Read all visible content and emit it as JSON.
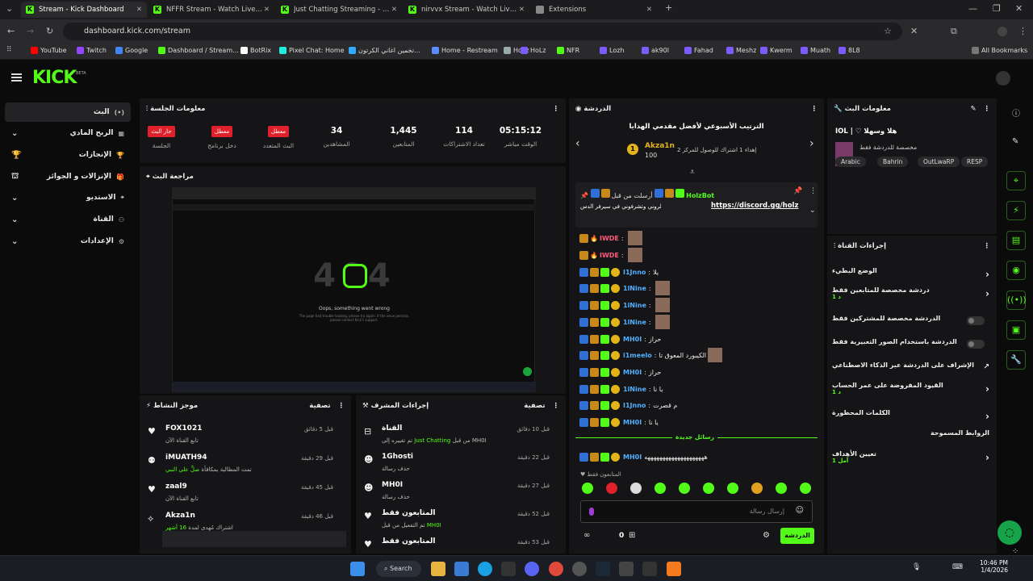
{
  "browser": {
    "tabs": [
      {
        "label": "Stream - Kick Dashboard",
        "active": true
      },
      {
        "label": "NFFR Stream - Watch Live on Ki",
        "active": false
      },
      {
        "label": "Just Chatting Streaming - Live",
        "active": false
      },
      {
        "label": "nirvvx Stream - Watch Live on K",
        "active": false
      },
      {
        "label": "Extensions",
        "active": false
      }
    ],
    "url": "dashboard.kick.com/stream",
    "bookmarks": [
      "YouTube",
      "Twitch",
      "Google",
      "Dashboard / Stream...",
      "BotRix",
      "Pixel Chat: Home",
      "تخمين اغاني الكرتون...",
      "Home - Restream",
      "HoLz",
      "HoLz",
      "NFR",
      "Lozh",
      "ak90l",
      "Fahad",
      "Meshz",
      "Kwerm",
      "Muath",
      "8L8"
    ],
    "all_bookmarks": "All Bookmarks"
  },
  "kick": {
    "logo": "KICK",
    "beta": "BETA"
  },
  "sidebar": {
    "items": [
      {
        "label": "البث",
        "icon": "(•)"
      },
      {
        "label": "الربح المادي",
        "icon": "▦"
      },
      {
        "label": "الإنجازات",
        "icon": "🏆"
      },
      {
        "label": "الإنزالات و الجوائز",
        "icon": "🎁"
      },
      {
        "label": "الاستديو",
        "icon": "⌖"
      },
      {
        "label": "القناة",
        "icon": "⚇"
      },
      {
        "label": "الإعدادات",
        "icon": "⚙"
      }
    ]
  },
  "session": {
    "title": "معلومات الجلسة",
    "stats": [
      {
        "value": "05:15:12",
        "label": "الوقت مباشر"
      },
      {
        "value": "114",
        "label": "تعداد الاشتراكات"
      },
      {
        "value": "1,445",
        "label": "المتابعين"
      },
      {
        "value": "34",
        "label": "المشاهدين"
      },
      {
        "value": "معطل",
        "label": "البث المتعدد",
        "badge": true
      },
      {
        "value": "معطل",
        "label": "دخل برنامج",
        "badge": true
      },
      {
        "value": "جار البث",
        "label": "الجلسة",
        "badge": true
      }
    ]
  },
  "preview": {
    "title": "مراجعة البث",
    "error_code": "404",
    "error_text": "Oops, something went wrong",
    "error_sub": "The page had trouble loading, please try again. If the issue persists, please contact Kick's support."
  },
  "activity": {
    "title": "موجز النشاط",
    "filter": "تصفية",
    "items": [
      {
        "name": "FOX1021",
        "desc": "تابع القناة الآن",
        "time": "قبل 5 دقائق",
        "icon": "heart-icon",
        "glyph": "♥"
      },
      {
        "name": "iMUATH94",
        "desc": "تمت المطالبة بمكافأة",
        "desc_highlight": "صلِّ على النبي",
        "time": "قبل 29 دقيقة",
        "icon": "reward-icon",
        "glyph": "⚉"
      },
      {
        "name": "zaal9",
        "desc": "تابع القناة الآن",
        "time": "قبل 45 دقيقة",
        "icon": "heart-icon",
        "glyph": "♥"
      },
      {
        "name": "Akza1n",
        "desc": "اشتراك مُهدى لمدة",
        "desc_highlight": "16 أشهر",
        "time": "قبل 46 دقيقة",
        "icon": "gift-icon",
        "glyph": "⟡"
      }
    ]
  },
  "mod": {
    "title": "إجراءات المشرف",
    "filter": "تصفية",
    "items": [
      {
        "name": "القناة",
        "desc": "تم تغييره إلى",
        "desc_highlight": "Just Chatting",
        "desc_tail": "من قبل MH0I",
        "time": "قبل 10 دقائق",
        "icon": "channel-icon",
        "glyph": "⊟"
      },
      {
        "name": "1Ghosti",
        "desc": "حذف رسالة",
        "time": "قبل 22 دقيقة",
        "icon": "user-icon",
        "glyph": "☻"
      },
      {
        "name": "MH0I",
        "desc": "حذف رسالة",
        "time": "قبل 27 دقيقة",
        "icon": "user-icon",
        "glyph": "☻"
      },
      {
        "name": "المتابعون فقط",
        "desc": "تم التفعيل من قبل",
        "desc_highlight": "MH0I",
        "time": "قبل 52 دقيقة",
        "icon": "heart-icon",
        "glyph": "♥"
      },
      {
        "name": "المتابعون فقط",
        "desc": "",
        "time": "قبل 53 دقيقة",
        "icon": "heart-icon",
        "glyph": "♥"
      }
    ]
  },
  "chat": {
    "title": "الدردشة",
    "leaderboard_title": "الترتيب الأسبوعي لأفضل مقدمي الهدايا",
    "top_gifter": {
      "rank": "1",
      "name": "Akza1n",
      "amount": "100"
    },
    "second_hint": "إهداء 1 اشتراك للوصول للمركز 2",
    "pinned": {
      "by": "أرسلت من قبل",
      "user": "HolzBot",
      "text": "حياكم للروني وتشرفوني في سيرفر الدس",
      "link": "https://discord.gg/holz"
    },
    "messages": [
      {
        "user": "IWDE",
        "color": "#ff5a7a",
        "text": "",
        "sticker": true
      },
      {
        "user": "IWDE",
        "color": "#ff5a7a",
        "text": "",
        "sticker": true
      },
      {
        "user": "I1Jnno",
        "color": "#4fb0ff",
        "text": "يلا",
        "sticker": false
      },
      {
        "user": "1lNine",
        "color": "#4fb0ff",
        "text": "",
        "sticker": true
      },
      {
        "user": "1lNine",
        "color": "#4fb0ff",
        "text": "",
        "sticker": true
      },
      {
        "user": "1lNine",
        "color": "#4fb0ff",
        "text": "",
        "sticker": true
      },
      {
        "user": "MH0I",
        "color": "#4fb0ff",
        "text": "حراز",
        "sticker": false
      },
      {
        "user": "i1meelo",
        "color": "#4fb0ff",
        "text": "الكيبورد المعوق تا",
        "sticker": true
      },
      {
        "user": "MH0I",
        "color": "#4fb0ff",
        "text": "حراز",
        "sticker": false
      },
      {
        "user": "1lNine",
        "color": "#4fb0ff",
        "text": "يا نا",
        "sticker": false
      },
      {
        "user": "I1Jnno",
        "color": "#4fb0ff",
        "text": "م قصرت",
        "sticker": false
      },
      {
        "user": "MH0I",
        "color": "#4fb0ff",
        "text": "يا نا",
        "sticker": false
      }
    ],
    "new_messages": "رسائل جديدة",
    "last_msg": {
      "user": "MH0I",
      "text": "ههههههههههههههههههههه"
    },
    "followers_only": "المتابعون فقط",
    "input_placeholder": "إرسال رسالة",
    "send_label": "الدردشة",
    "points": "0"
  },
  "stream_info": {
    "title": "معلومات البث",
    "stream_title": "IOL | ♡ هلا وسهلا",
    "category": "مخصصة للدردشة فقط",
    "tags": [
      "Arabic",
      "Bahrin",
      "OutLwaRP",
      "RESP"
    ]
  },
  "channel_actions": {
    "title": "إجراءات القناة",
    "rows": [
      {
        "label": "الوضع البطيء",
        "sub": "",
        "control": "chevron"
      },
      {
        "label": "دردشة مخصصة للمتابعين فقط",
        "sub": "1 د",
        "control": "chevron"
      },
      {
        "label": "الدردشة مخصصة للمشتركين فقط",
        "sub": "",
        "control": "toggle"
      },
      {
        "label": "الدردشة باستخدام الصور التعبيرية فقط",
        "sub": "",
        "control": "toggle"
      },
      {
        "label": "الإشراف على الدردشة عبر الذكاء الاصطناعي",
        "sub": "",
        "control": "external"
      },
      {
        "label": "القيود المفروضة على عمر الحساب",
        "sub": "1 د",
        "control": "chevron"
      },
      {
        "label": "الكلمات المحظورة",
        "sub": "",
        "control": "chevron"
      },
      {
        "label": "الروابط المسموحة",
        "sub": "",
        "control": "none"
      },
      {
        "label": "تعيين الأهداف",
        "sub": "1 أمل",
        "control": "chevron"
      }
    ]
  },
  "taskbar": {
    "search": "Search",
    "time": "10:46 PM",
    "date": "1/4/2026"
  },
  "colors": {
    "accent": "#53fc18",
    "danger": "#e0212b",
    "panel": "#151517"
  }
}
